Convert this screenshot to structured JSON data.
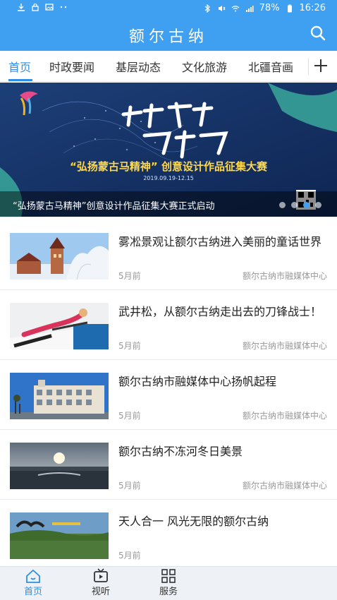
{
  "status_bar": {
    "battery": "78%",
    "time": "16:26",
    "left_icons": [
      "download-icon",
      "lock-icon",
      "image-icon",
      "more-dots-icon"
    ],
    "right_icons": [
      "bluetooth-icon",
      "mute-icon",
      "wifi-icon",
      "signal-icon",
      "battery-icon"
    ]
  },
  "app_bar": {
    "title": "额尔古纳",
    "search_icon": "search-icon"
  },
  "tabs": [
    {
      "label": "首页",
      "active": true
    },
    {
      "label": "时政要闻",
      "active": false
    },
    {
      "label": "基层动态",
      "active": false
    },
    {
      "label": "文化旅游",
      "active": false
    },
    {
      "label": "北疆音画",
      "active": false
    }
  ],
  "tabs_add_icon": "plus-icon",
  "banner": {
    "calligraphy": "创意草原 马当先",
    "headline": "“弘扬蒙古马精神” 创意设计作品征集大赛",
    "date": "2019.09.19-12.15",
    "caption": "“弘扬蒙古马精神”创意设计作品征集大赛正式启动",
    "dots_total": 4,
    "dots_active_index": 2
  },
  "news": [
    {
      "title": "雾凇景观让额尔古纳进入美丽的童话世界",
      "time": "5月前",
      "source": "额尔古纳市融媒体中心"
    },
    {
      "title": "武井松，从额尔古纳走出去的刀锋战士！",
      "time": "5月前",
      "source": "额尔古纳市融媒体中心"
    },
    {
      "title": "额尔古纳市融媒体中心扬帆起程",
      "time": "5月前",
      "source": "额尔古纳市融媒体中心"
    },
    {
      "title": "额尔古纳不冻河冬日美景",
      "time": "5月前",
      "source": "额尔古纳市融媒体中心"
    },
    {
      "title": "天人合一 风光无限的额尔古纳",
      "time": "5月前",
      "source": ""
    }
  ],
  "bottom_nav": [
    {
      "label": "首页",
      "icon": "home-icon",
      "active": true
    },
    {
      "label": "视听",
      "icon": "tv-icon",
      "active": false
    },
    {
      "label": "服务",
      "icon": "grid-icon",
      "active": false
    }
  ],
  "colors": {
    "primary": "#3f9ff0",
    "active_tab": "#2f8fe6",
    "banner_headline": "#ffd84a"
  }
}
